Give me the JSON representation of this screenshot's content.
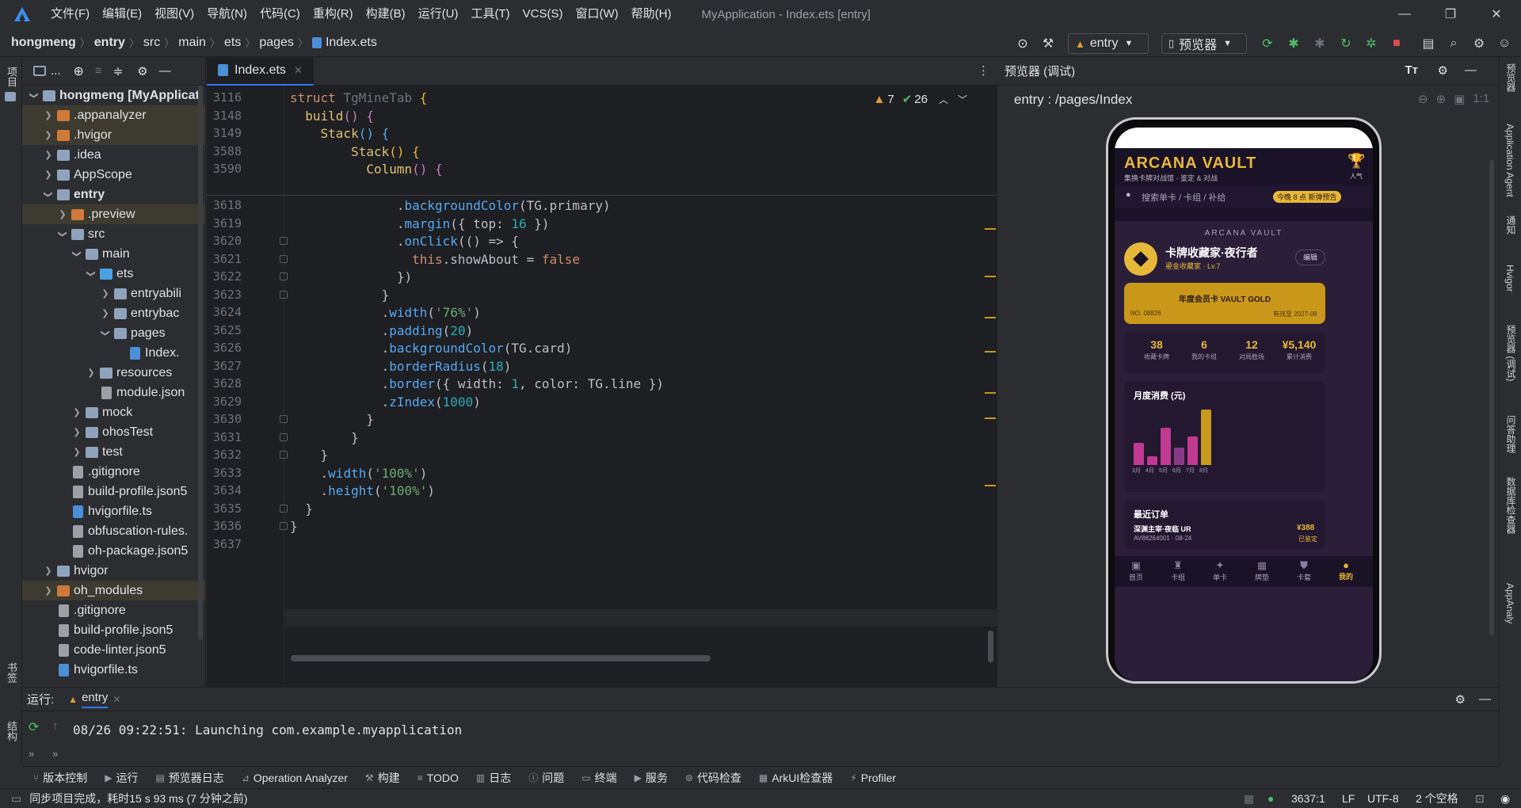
{
  "titlebar": {
    "menus": [
      "文件(F)",
      "编辑(E)",
      "视图(V)",
      "导航(N)",
      "代码(C)",
      "重构(R)",
      "构建(B)",
      "运行(U)",
      "工具(T)",
      "VCS(S)",
      "窗口(W)",
      "帮助(H)"
    ],
    "window_title": "MyApplication - Index.ets [entry]"
  },
  "breadcrumb": {
    "items": [
      "hongmeng",
      "entry",
      "src",
      "main",
      "ets",
      "pages",
      "Index.ets"
    ],
    "run_config": "entry",
    "previewer_label": "预览器"
  },
  "left_strip": {
    "top_label": "项目",
    "bottom_label1": "书签",
    "bottom_label2": "结构"
  },
  "project_tree": {
    "nodes": [
      {
        "label": "hongmeng [MyApplicati",
        "indent": 0,
        "arrow": "▾",
        "icon": "folder",
        "bold": true
      },
      {
        "label": ".appanalyzer",
        "indent": 1,
        "arrow": "›",
        "icon": "folder-orange",
        "hl": true
      },
      {
        "label": ".hvigor",
        "indent": 1,
        "arrow": "›",
        "icon": "folder-orange",
        "hl": true
      },
      {
        "label": ".idea",
        "indent": 1,
        "arrow": "›",
        "icon": "folder"
      },
      {
        "label": "AppScope",
        "indent": 1,
        "arrow": "›",
        "icon": "folder"
      },
      {
        "label": "entry",
        "indent": 1,
        "arrow": "▾",
        "icon": "folder",
        "bold": true
      },
      {
        "label": ".preview",
        "indent": 2,
        "arrow": "›",
        "icon": "folder-orange",
        "hl": true
      },
      {
        "label": "src",
        "indent": 2,
        "arrow": "▾",
        "icon": "folder"
      },
      {
        "label": "main",
        "indent": 3,
        "arrow": "▾",
        "icon": "folder"
      },
      {
        "label": "ets",
        "indent": 4,
        "arrow": "▾",
        "icon": "folder-blue"
      },
      {
        "label": "entryabili",
        "indent": 5,
        "arrow": "›",
        "icon": "folder"
      },
      {
        "label": "entrybac",
        "indent": 5,
        "arrow": "›",
        "icon": "folder"
      },
      {
        "label": "pages",
        "indent": 5,
        "arrow": "▾",
        "icon": "folder"
      },
      {
        "label": "Index.",
        "indent": 6,
        "arrow": "",
        "icon": "file-ts"
      },
      {
        "label": "resources",
        "indent": 4,
        "arrow": "›",
        "icon": "folder"
      },
      {
        "label": "module.json",
        "indent": 4,
        "arrow": "",
        "icon": "file"
      },
      {
        "label": "mock",
        "indent": 3,
        "arrow": "›",
        "icon": "folder"
      },
      {
        "label": "ohosTest",
        "indent": 3,
        "arrow": "›",
        "icon": "folder"
      },
      {
        "label": "test",
        "indent": 3,
        "arrow": "›",
        "icon": "folder"
      },
      {
        "label": ".gitignore",
        "indent": 2,
        "arrow": "",
        "icon": "file"
      },
      {
        "label": "build-profile.json5",
        "indent": 2,
        "arrow": "",
        "icon": "file"
      },
      {
        "label": "hvigorfile.ts",
        "indent": 2,
        "arrow": "",
        "icon": "file-ts"
      },
      {
        "label": "obfuscation-rules.",
        "indent": 2,
        "arrow": "",
        "icon": "file"
      },
      {
        "label": "oh-package.json5",
        "indent": 2,
        "arrow": "",
        "icon": "file"
      },
      {
        "label": "hvigor",
        "indent": 1,
        "arrow": "›",
        "icon": "folder"
      },
      {
        "label": "oh_modules",
        "indent": 1,
        "arrow": "›",
        "icon": "folder-orange",
        "hl": true
      },
      {
        "label": ".gitignore",
        "indent": 1,
        "arrow": "",
        "icon": "file"
      },
      {
        "label": "build-profile.json5",
        "indent": 1,
        "arrow": "",
        "icon": "file"
      },
      {
        "label": "code-linter.json5",
        "indent": 1,
        "arrow": "",
        "icon": "file"
      },
      {
        "label": "hvigorfile.ts",
        "indent": 1,
        "arrow": "",
        "icon": "file-ts"
      }
    ]
  },
  "editor": {
    "tab": "Index.ets",
    "warnings": "7",
    "checks": "26",
    "sticky_lines": [
      {
        "n": "3116",
        "html": "<span class='kw'>struct</span> <span style='color:#6f737a'>TgMineTab</span> <span class='mt'>{</span>"
      },
      {
        "n": "3148",
        "html": "  <span class='fnm'>build</span><span class='prop'>()</span> <span class='prop'>{</span>"
      },
      {
        "n": "3149",
        "html": "    <span class='fnm'>Stack</span><span class='fn'>()</span> <span class='fn'>{</span>"
      },
      {
        "n": "3588",
        "html": "        <span class='fnm'>Stack</span><span class='mt'>()</span> <span class='mt'>{</span>"
      },
      {
        "n": "3590",
        "html": "          <span class='fnm'>Column</span><span class='prop'>()</span> <span class='prop'>{</span>"
      }
    ],
    "lines": [
      {
        "n": "3618",
        "html": "              .<span class='fn'>backgroundColor</span>(TG.primary)"
      },
      {
        "n": "3619",
        "html": "              .<span class='fn'>margin</span>({ top: <span class='num'>16</span> })"
      },
      {
        "n": "3620",
        "html": "              .<span class='fn'>onClick</span>(() => {"
      },
      {
        "n": "3621",
        "html": "                <span class='kw'>this</span>.showAbout = <span class='kw'>false</span>"
      },
      {
        "n": "3622",
        "html": "              })"
      },
      {
        "n": "3623",
        "html": "            }"
      },
      {
        "n": "3624",
        "html": "            .<span class='fn'>width</span>(<span class='str'>'76%'</span>)"
      },
      {
        "n": "3625",
        "html": "            .<span class='fn'>padding</span>(<span class='num'>20</span>)"
      },
      {
        "n": "3626",
        "html": "            .<span class='fn'>backgroundColor</span>(TG.card)"
      },
      {
        "n": "3627",
        "html": "            .<span class='fn'>borderRadius</span>(<span class='num'>18</span>)"
      },
      {
        "n": "3628",
        "html": "            .<span class='fn'>border</span>({ width: <span class='num'>1</span>, color: TG.line })"
      },
      {
        "n": "3629",
        "html": "            .<span class='fn'>zIndex</span>(<span class='num'>1000</span>)"
      },
      {
        "n": "3630",
        "html": "          }"
      },
      {
        "n": "3631",
        "html": "        }"
      },
      {
        "n": "3632",
        "html": "    }"
      },
      {
        "n": "3633",
        "html": "    .<span class='fn'>width</span>(<span class='str'>'100%'</span>)"
      },
      {
        "n": "3634",
        "html": "    .<span class='fn'>height</span>(<span class='str'>'100%'</span>)"
      },
      {
        "n": "3635",
        "html": "  }"
      },
      {
        "n": "3636",
        "html": "}"
      },
      {
        "n": "3637",
        "html": ""
      }
    ]
  },
  "preview": {
    "header": "预览器 (调试)",
    "route": "entry : /pages/Index",
    "app": {
      "brand": "ARCANA VAULT",
      "tagline": "集换卡牌对战馆 · 鉴定 & 对战",
      "trophy_label": "人气",
      "search_placeholder": "搜索单卡 / 卡组 / 补给",
      "promo_badge": "今晚 8 点 新弹预告",
      "profile_brand": "ARCANA VAULT",
      "profile_name": "卡牌收藏家·夜行者",
      "profile_level": "鎏金收藏家 · Lv.7",
      "edit_btn": "编辑",
      "vip_title": "年度会员卡 VAULT GOLD",
      "vip_no": "NO. 08826",
      "vip_valid": "有效至 2027-08",
      "stats": [
        {
          "value": "38",
          "label": "收藏卡牌"
        },
        {
          "value": "6",
          "label": "我的卡组"
        },
        {
          "value": "12",
          "label": "对局胜场"
        },
        {
          "value": "¥5,140",
          "label": "累计消费"
        }
      ],
      "chart_title": "月度消费 (元)",
      "chart_data": {
        "type": "bar",
        "categories": [
          "3月",
          "4月",
          "5月",
          "6月",
          "7月",
          "8月"
        ],
        "values": [
          28,
          11,
          47,
          22,
          36,
          70
        ],
        "colors": [
          "#c13a91",
          "#c13a91",
          "#c13a91",
          "#8a3a86",
          "#c13a91",
          "#c79a1e"
        ]
      },
      "orders_title": "最近订单",
      "order_name": "深渊主宰·夜临 UR",
      "order_id": "AV88264001 · 08-24",
      "order_price": "¥388",
      "order_status": "已鉴定",
      "nav": [
        "首页",
        "卡组",
        "单卡",
        "牌垫",
        "卡套",
        "我的"
      ]
    }
  },
  "right_strip": [
    "预览器",
    "Application Agent",
    "通知",
    "Hvigor",
    "预览器 (调试)",
    "问答助理",
    "数据库检查器",
    "AppAnaly"
  ],
  "run": {
    "label": "运行:",
    "tab": "entry",
    "log": "08/26 09:22:51: Launching com.example.myapplication"
  },
  "bottom_tools": [
    "版本控制",
    "运行",
    "预览器日志",
    "Operation Analyzer",
    "构建",
    "TODO",
    "日志",
    "问题",
    "终端",
    "服务",
    "代码检查",
    "ArkUI检查器",
    "Profiler"
  ],
  "status": {
    "message": "同步项目完成，耗时15 s 93 ms (7 分钟之前)",
    "position": "3637:1",
    "line_sep": "LF",
    "encoding": "UTF-8",
    "indent": "2 个空格"
  }
}
